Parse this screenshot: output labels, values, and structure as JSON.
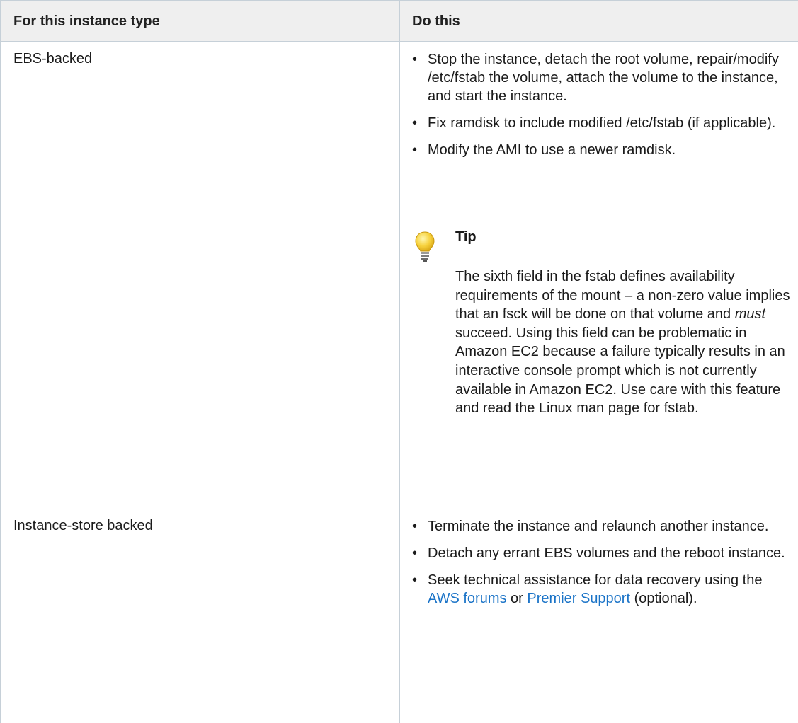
{
  "table": {
    "headers": [
      "For this instance type",
      "Do this"
    ],
    "rows": [
      {
        "type": "EBS-backed",
        "actions": [
          "Stop the instance, detach the root volume, repair/modify /etc/fstab the volume, attach the volume to the instance, and start the instance.",
          "Fix ramdisk to include modified /etc/fstab (if applicable).",
          "Modify the AMI to use a newer ramdisk."
        ],
        "tip": {
          "icon": "lightbulb-icon",
          "title": "Tip",
          "text_before": "The sixth field in the fstab defines availability requirements of the mount – a non-zero value implies that an fsck will be done on that volume and ",
          "emphasis": "must",
          "text_after": " succeed. Using this field can be problematic in Amazon EC2 because a failure typically results in an interactive console prompt which is not currently available in Amazon EC2. Use care with this feature and read the Linux man page for fstab."
        }
      },
      {
        "type": "Instance-store backed",
        "actions": [
          "Terminate the instance and relaunch another instance.",
          "Detach any errant EBS volumes and the reboot instance."
        ],
        "last_action": {
          "text_before": "Seek technical assistance for data recovery using the ",
          "link1": "AWS forums",
          "text_middle": " or ",
          "link2": "Premier Support",
          "text_after": " (optional)."
        }
      }
    ]
  },
  "colors": {
    "header_bg": "#efefef",
    "border": "#c6d0d8",
    "link": "#1a73c7",
    "bulb": "#f7d23e"
  }
}
